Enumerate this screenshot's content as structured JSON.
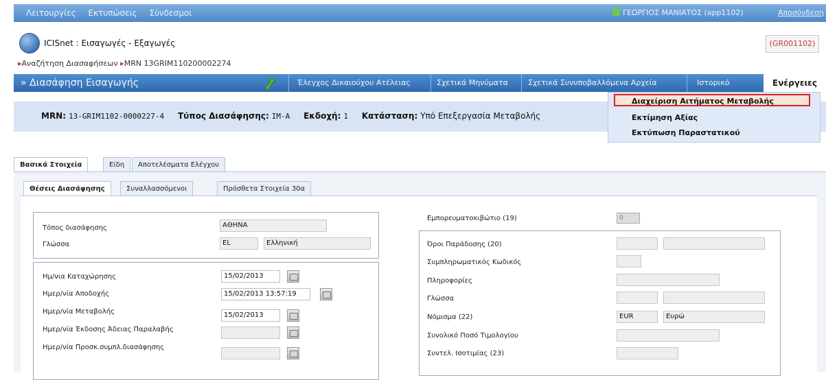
{
  "topbar": {
    "menu": [
      "Λειτουργίες",
      "Εκτυπώσεις",
      "Σύνδεσμοι"
    ],
    "user": "ΓΕΩΡΓΙΟΣ ΜΑΝΙΑΤΟΣ (app1102)",
    "logout": "Αποσύνδεση"
  },
  "header": {
    "app_title": "ICISnet : Εισαγωγές - Εξαγωγές",
    "office_code": "(GR001102)"
  },
  "breadcrumb": {
    "item1": "Αναζήτηση Διασαφήσεων",
    "item2": "MRN 13GRIM110200002274"
  },
  "nav": {
    "title": "» Διασάφηση Εισαγωγής",
    "tabs": [
      "Έλεγχος Δικαιούχου Ατέλειας",
      "Σχετικά Μηνύματα",
      "Σχετικά Συνυποβαλλόμενα Αρχεία",
      "Ιστορικό"
    ],
    "actions": "Ενέργειες"
  },
  "dropdown": {
    "items": [
      "Διαχείριση Αιτήματος Μεταβολής",
      "Εκτίμηση Αξίας",
      "Εκτύπωση Παραστατικού"
    ]
  },
  "info": {
    "mrn_label": "MRN:",
    "mrn_value": "13-GRIM1102-0000227-4",
    "type_label": "Τύπος Διασάφησης:",
    "type_value": "IM-A",
    "version_label": "Εκδοχή:",
    "version_value": "1",
    "status_label": "Κατάσταση:",
    "status_value": "Υπό Επεξεργασία Μεταβολής"
  },
  "main_tabs": [
    "Βασικά Στοιχεία",
    "Είδη",
    "Αποτελέσματα Ελέγχου"
  ],
  "sub_tabs": [
    "Θέσεις Διασάφησης",
    "Συναλλασσόμενοι",
    "Πρόσθετα Στοιχεία 30α"
  ],
  "left_form": {
    "place_label": "Τόπος διασάφησης",
    "place_value": "ΑΘΗΝΑ",
    "language_label": "Γλώσσα",
    "language_code": "EL",
    "language_name": "Ελληνική",
    "registration_date_label": "Ημ/νια Καταχώρησης",
    "registration_date": "15/02/2013",
    "acceptance_date_label": "Ημερ/νία Αποδοχής",
    "acceptance_date": "15/02/2013 13:57:19",
    "change_date_label": "Ημερ/νία Μεταβολής",
    "change_date": "15/02/2013",
    "permit_date_label": "Ημερ/νία Έκδοσης Άδειας Παραλαβής",
    "permit_date": "",
    "supplementary_date_label": "Ημερ/νία Προσκ.συμπλ.διασάφησης",
    "supplementary_date": ""
  },
  "right_form": {
    "container_label": "Εμπορευματοκιβώτιο (19)",
    "container_value": "0",
    "delivery_terms_label": "Όροι Παράδοσης (20)",
    "supplementary_code_label": "Συμπληρωματικός Κωδικός",
    "information_label": "Πληροφορίες",
    "language_label": "Γλώσσα",
    "currency_label": "Νόμισμα (22)",
    "currency_code": "EUR",
    "currency_name": "Ευρώ",
    "invoice_total_label": "Συνολικό Ποσό Τιμολογίου",
    "exchange_rate_label": "Συντελ. Ισοτιμίας (23)"
  }
}
